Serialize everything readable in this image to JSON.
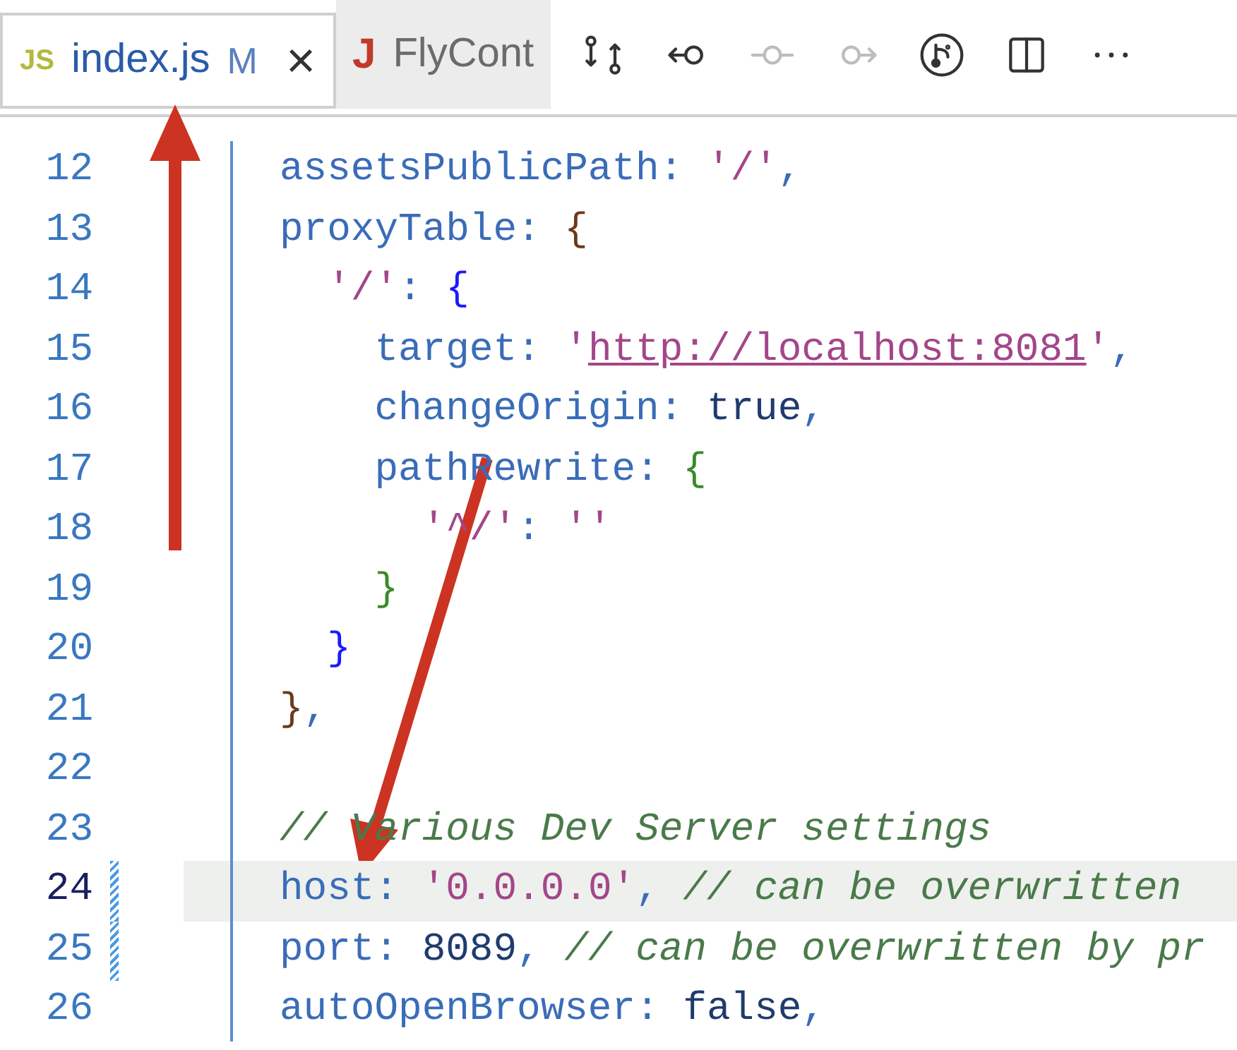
{
  "tabs": [
    {
      "icon_text": "JS",
      "color": "#b4b83c",
      "label": "index.js",
      "status": "M",
      "close": "×",
      "selected": true
    },
    {
      "icon_text": "J",
      "color": "#c0392b",
      "label": "FlyCont",
      "selected": false
    }
  ],
  "toolbar": [
    {
      "kind": "compare",
      "disabled": false
    },
    {
      "kind": "previous",
      "disabled": false
    },
    {
      "kind": "dot",
      "disabled": true
    },
    {
      "kind": "next",
      "disabled": true
    },
    {
      "kind": "branch",
      "disabled": false
    },
    {
      "kind": "split",
      "disabled": false
    },
    {
      "kind": "more",
      "disabled": false
    }
  ],
  "lines": [
    {
      "number": "12",
      "current": false,
      "changed": false,
      "tokens": [
        {
          "kind": "prop",
          "text": "assetsPublicPath"
        },
        {
          "kind": "punct",
          "text": ": "
        },
        {
          "kind": "string",
          "text": "'/'"
        },
        {
          "kind": "punct",
          "text": ","
        }
      ]
    },
    {
      "number": "13",
      "current": false,
      "changed": false,
      "tokens": [
        {
          "kind": "prop",
          "text": "proxyTable"
        },
        {
          "kind": "punct",
          "text": ": "
        },
        {
          "kind": "brace1",
          "text": "{"
        }
      ]
    },
    {
      "number": "14",
      "current": false,
      "changed": false,
      "tokens": [
        {
          "kind": "string",
          "text": "  '/'"
        },
        {
          "kind": "punct",
          "text": ": "
        },
        {
          "kind": "brace2",
          "text": "{"
        }
      ]
    },
    {
      "number": "15",
      "current": false,
      "changed": false,
      "tokens": [
        {
          "kind": "prop",
          "text": "    target"
        },
        {
          "kind": "punct",
          "text": ": "
        },
        {
          "kind": "string",
          "text": "'"
        },
        {
          "kind": "link",
          "text": "http://localhost:8081"
        },
        {
          "kind": "string",
          "text": "'"
        },
        {
          "kind": "punct",
          "text": ","
        }
      ]
    },
    {
      "number": "16",
      "current": false,
      "changed": false,
      "tokens": [
        {
          "kind": "prop",
          "text": "    changeOrigin"
        },
        {
          "kind": "punct",
          "text": ": "
        },
        {
          "kind": "value",
          "text": "true"
        },
        {
          "kind": "punct",
          "text": ","
        }
      ]
    },
    {
      "number": "17",
      "current": false,
      "changed": false,
      "tokens": [
        {
          "kind": "prop",
          "text": "    pathRewrite"
        },
        {
          "kind": "punct",
          "text": ": "
        },
        {
          "kind": "brace3",
          "text": "{"
        }
      ]
    },
    {
      "number": "18",
      "current": false,
      "changed": false,
      "tokens": [
        {
          "kind": "string",
          "text": "      '^/'"
        },
        {
          "kind": "punct",
          "text": ": "
        },
        {
          "kind": "string",
          "text": "''"
        }
      ]
    },
    {
      "number": "19",
      "current": false,
      "changed": false,
      "tokens": [
        {
          "kind": "brace3",
          "text": "    }"
        }
      ]
    },
    {
      "number": "20",
      "current": false,
      "changed": false,
      "tokens": [
        {
          "kind": "brace2",
          "text": "  }"
        }
      ]
    },
    {
      "number": "21",
      "current": false,
      "changed": false,
      "tokens": [
        {
          "kind": "brace1",
          "text": "}"
        },
        {
          "kind": "punct",
          "text": ","
        }
      ]
    },
    {
      "number": "22",
      "current": false,
      "changed": false
    },
    {
      "number": "23",
      "current": false,
      "changed": false,
      "tokens": [
        {
          "kind": "comment",
          "text": "// Various Dev Server settings"
        }
      ]
    },
    {
      "number": "24",
      "current": true,
      "changed": true,
      "tokens": [
        {
          "kind": "prop",
          "text": "host"
        },
        {
          "kind": "punct",
          "text": ": "
        },
        {
          "kind": "string",
          "text": "'0.0.0.0'"
        },
        {
          "kind": "punct",
          "text": ", "
        },
        {
          "kind": "comment",
          "text": "// can be overwritten "
        }
      ]
    },
    {
      "number": "25",
      "current": false,
      "changed": true,
      "tokens": [
        {
          "kind": "prop",
          "text": "port"
        },
        {
          "kind": "punct",
          "text": ": "
        },
        {
          "kind": "value",
          "text": "8089"
        },
        {
          "kind": "punct",
          "text": ", "
        },
        {
          "kind": "comment",
          "text": "// can be overwritten by pr"
        }
      ]
    },
    {
      "number": "26",
      "current": false,
      "changed": false,
      "tokens": [
        {
          "kind": "prop",
          "text": "autoOpenBrowser"
        },
        {
          "kind": "punct",
          "text": ": "
        },
        {
          "kind": "value",
          "text": "false"
        },
        {
          "kind": "punct",
          "text": ","
        }
      ]
    }
  ]
}
